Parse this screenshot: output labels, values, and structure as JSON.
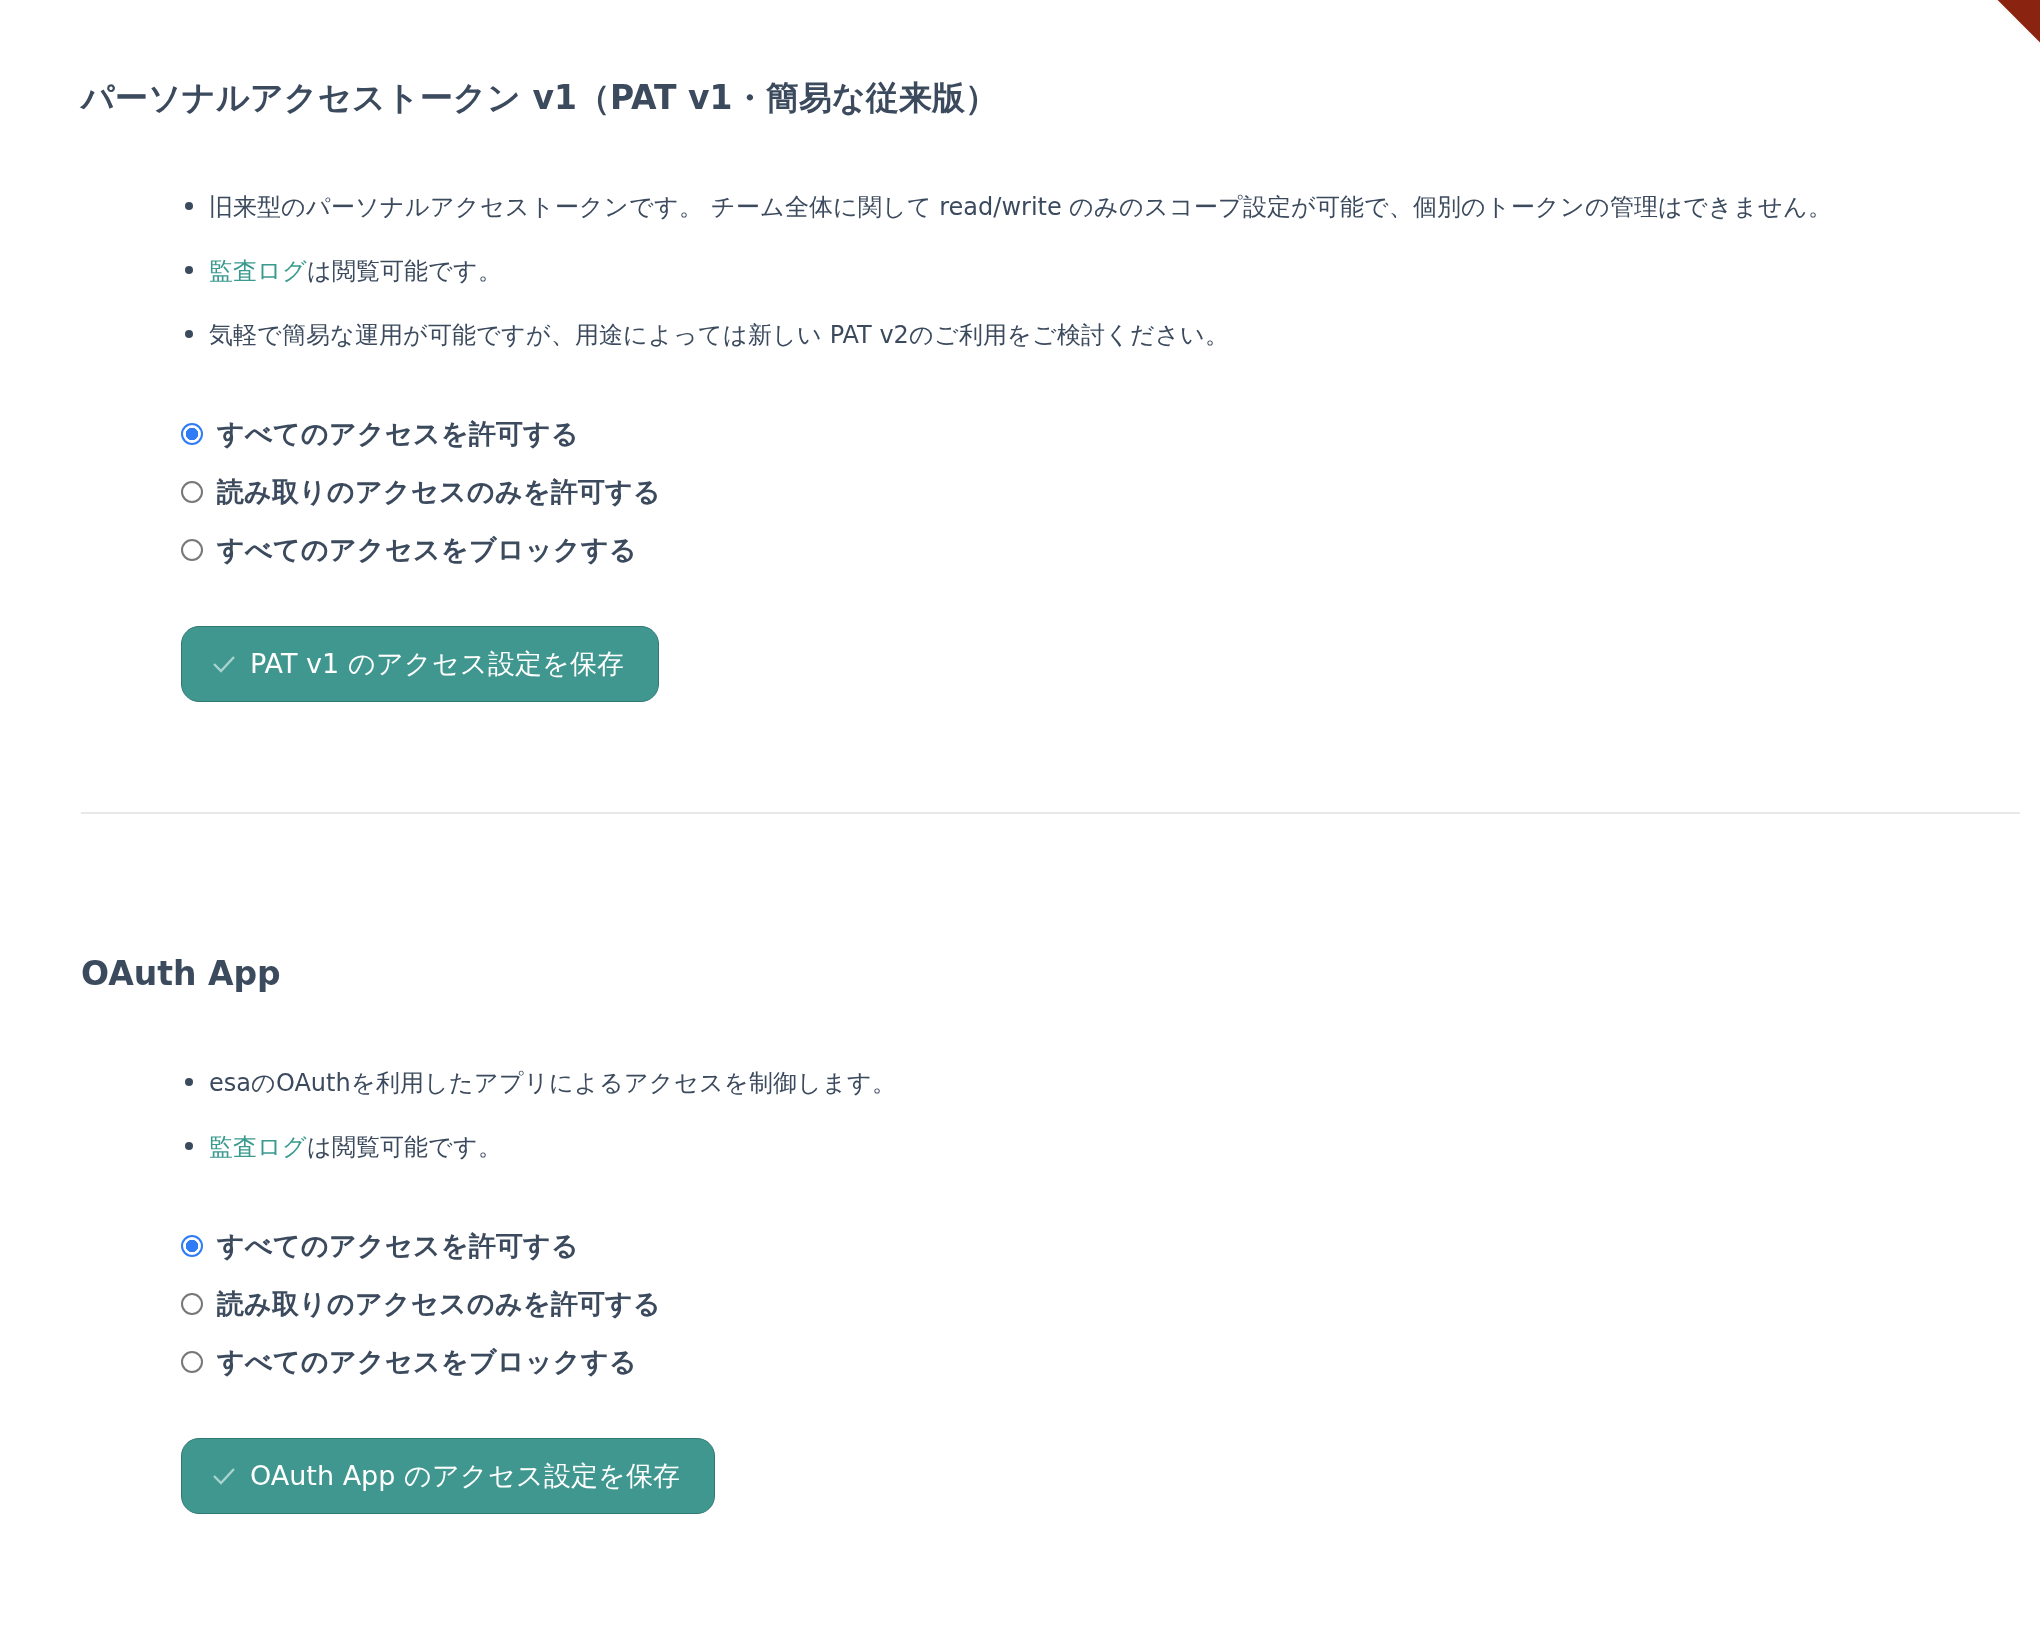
{
  "sections": [
    {
      "title": "パーソナルアクセストークン v1（PAT v1・簡易な従来版）",
      "notes": [
        {
          "text": "旧来型のパーソナルアクセストークンです。 チーム全体に関して read/write のみのスコープ設定が可能で、個別のトークンの管理はできません。"
        },
        {
          "link": "監査ログ",
          "text": "は閲覧可能です。"
        },
        {
          "text": "気軽で簡易な運用が可能ですが、用途によっては新しい PAT v2のご利用をご検討ください。"
        }
      ],
      "options": [
        {
          "label": "すべてのアクセスを許可する",
          "selected": true
        },
        {
          "label": "読み取りのアクセスのみを許可する",
          "selected": false
        },
        {
          "label": "すべてのアクセスをブロックする",
          "selected": false
        }
      ],
      "button": "PAT v1 のアクセス設定を保存"
    },
    {
      "title": "OAuth App",
      "notes": [
        {
          "text": "esaのOAuthを利用したアプリによるアクセスを制御します。"
        },
        {
          "link": "監査ログ",
          "text": "は閲覧可能です。"
        }
      ],
      "options": [
        {
          "label": "すべてのアクセスを許可する",
          "selected": true
        },
        {
          "label": "読み取りのアクセスのみを許可する",
          "selected": false
        },
        {
          "label": "すべてのアクセスをブロックする",
          "selected": false
        }
      ],
      "button": "OAuth App のアクセス設定を保存"
    }
  ]
}
